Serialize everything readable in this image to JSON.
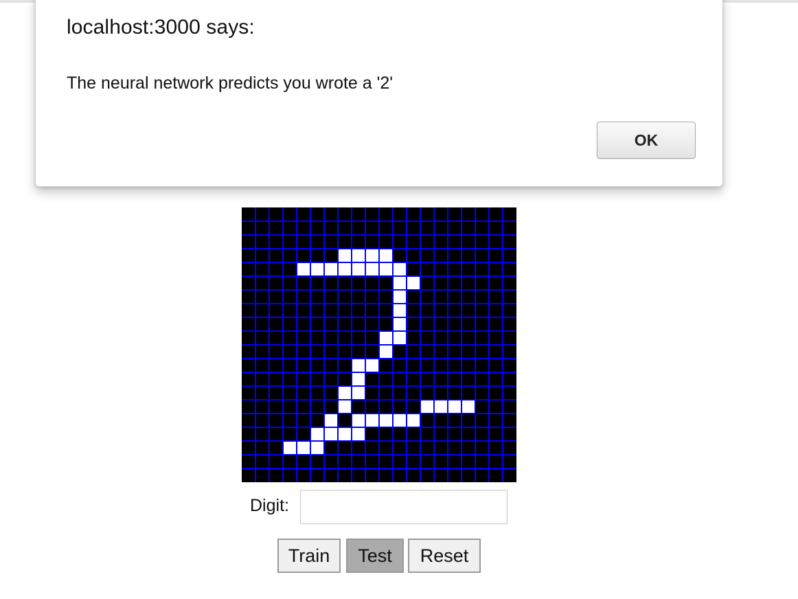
{
  "alert": {
    "title": "localhost:3000 says:",
    "message": "The neural network predicts you wrote a '2'",
    "ok_label": "OK"
  },
  "canvas": {
    "grid_size": 20,
    "background_color": "#000000",
    "grid_color": "#0000ff",
    "pixel_color": "#ffffff",
    "drawn_cells": [
      [
        7,
        3
      ],
      [
        8,
        3
      ],
      [
        9,
        3
      ],
      [
        10,
        3
      ],
      [
        4,
        4
      ],
      [
        5,
        4
      ],
      [
        6,
        4
      ],
      [
        7,
        4
      ],
      [
        8,
        4
      ],
      [
        9,
        4
      ],
      [
        10,
        4
      ],
      [
        11,
        4
      ],
      [
        11,
        5
      ],
      [
        12,
        5
      ],
      [
        11,
        6
      ],
      [
        11,
        7
      ],
      [
        11,
        8
      ],
      [
        10,
        9
      ],
      [
        11,
        9
      ],
      [
        10,
        10
      ],
      [
        8,
        11
      ],
      [
        9,
        11
      ],
      [
        8,
        12
      ],
      [
        7,
        13
      ],
      [
        8,
        13
      ],
      [
        7,
        14
      ],
      [
        13,
        14
      ],
      [
        14,
        14
      ],
      [
        15,
        14
      ],
      [
        16,
        14
      ],
      [
        6,
        15
      ],
      [
        8,
        15
      ],
      [
        9,
        15
      ],
      [
        10,
        15
      ],
      [
        11,
        15
      ],
      [
        12,
        15
      ],
      [
        5,
        16
      ],
      [
        6,
        16
      ],
      [
        7,
        16
      ],
      [
        8,
        16
      ],
      [
        3,
        17
      ],
      [
        4,
        17
      ],
      [
        5,
        17
      ]
    ]
  },
  "form": {
    "digit_label": "Digit:",
    "digit_value": ""
  },
  "buttons": {
    "train": "Train",
    "test": "Test",
    "reset": "Reset"
  }
}
